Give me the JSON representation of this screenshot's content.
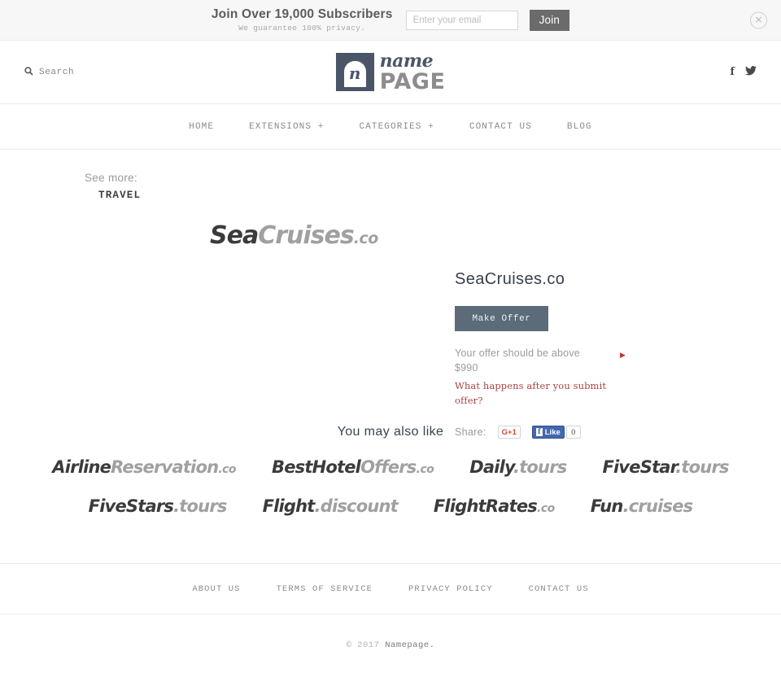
{
  "subscribe": {
    "headline": "Join Over 19,000 Subscribers",
    "subtext": "We guarantee 100% privacy.",
    "email_placeholder": "Enter your email",
    "email_value": "",
    "join_label": "Join",
    "close_glyph": "✕"
  },
  "header": {
    "search_label": "Search",
    "search_glyph": "🔍",
    "logo": {
      "mark_letter": "n",
      "name": "name",
      "page": "PAGE"
    },
    "social": {
      "facebook": "f",
      "twitter": "🐦"
    }
  },
  "nav": {
    "items": [
      {
        "label": "HOME"
      },
      {
        "label": "EXTENSIONS +"
      },
      {
        "label": "CATEGORIES +"
      },
      {
        "label": "CONTACT US"
      },
      {
        "label": "BLOG"
      }
    ]
  },
  "main": {
    "see_more_label": "See more:",
    "see_more_value": "TRAVEL",
    "hero": {
      "dark": "Sea",
      "light": "Cruises",
      "tld": ".co"
    },
    "offer": {
      "title": "SeaCruises.co",
      "button_label": "Make Offer",
      "note_line1": "Your offer should be above",
      "note_line2": "$990",
      "arrow_glyph": "▶",
      "link_label": "What happens after you submit offer?",
      "share_label": "Share:",
      "gplus_label": "G+1",
      "fb_icon": "f",
      "fb_like_label": "Like",
      "fb_count": "0"
    },
    "also_title": "You may also like",
    "also_rows": [
      [
        {
          "dark": "Airline",
          "light": "Reservation",
          "tld": ".co"
        },
        {
          "dark": "BestHotel",
          "light": "Offers",
          "tld": ".co"
        },
        {
          "dark": "Daily",
          "light": ".tours",
          "tld": ""
        },
        {
          "dark": "FiveStar",
          "light": ".tours",
          "tld": ""
        }
      ],
      [
        {
          "dark": "FiveStars",
          "light": ".tours",
          "tld": ""
        },
        {
          "dark": "Flight",
          "light": ".discount",
          "tld": ""
        },
        {
          "dark": "FlightRates",
          "light": "",
          "tld": ".co"
        },
        {
          "dark": "Fun",
          "light": ".cruises",
          "tld": ""
        }
      ]
    ]
  },
  "footer": {
    "links": [
      {
        "label": "ABOUT US"
      },
      {
        "label": "TERMS OF SERVICE"
      },
      {
        "label": "PRIVACY POLICY"
      },
      {
        "label": "CONTACT US"
      }
    ],
    "copyright_year": "© 2017 ",
    "copyright_name": "Namepage."
  },
  "colors": {
    "accent_slate": "#5c6b7a",
    "link_red": "#a94442",
    "facebook_blue": "#4267b2",
    "gplus_red": "#d34836",
    "logo_navy": "#4a5568"
  }
}
